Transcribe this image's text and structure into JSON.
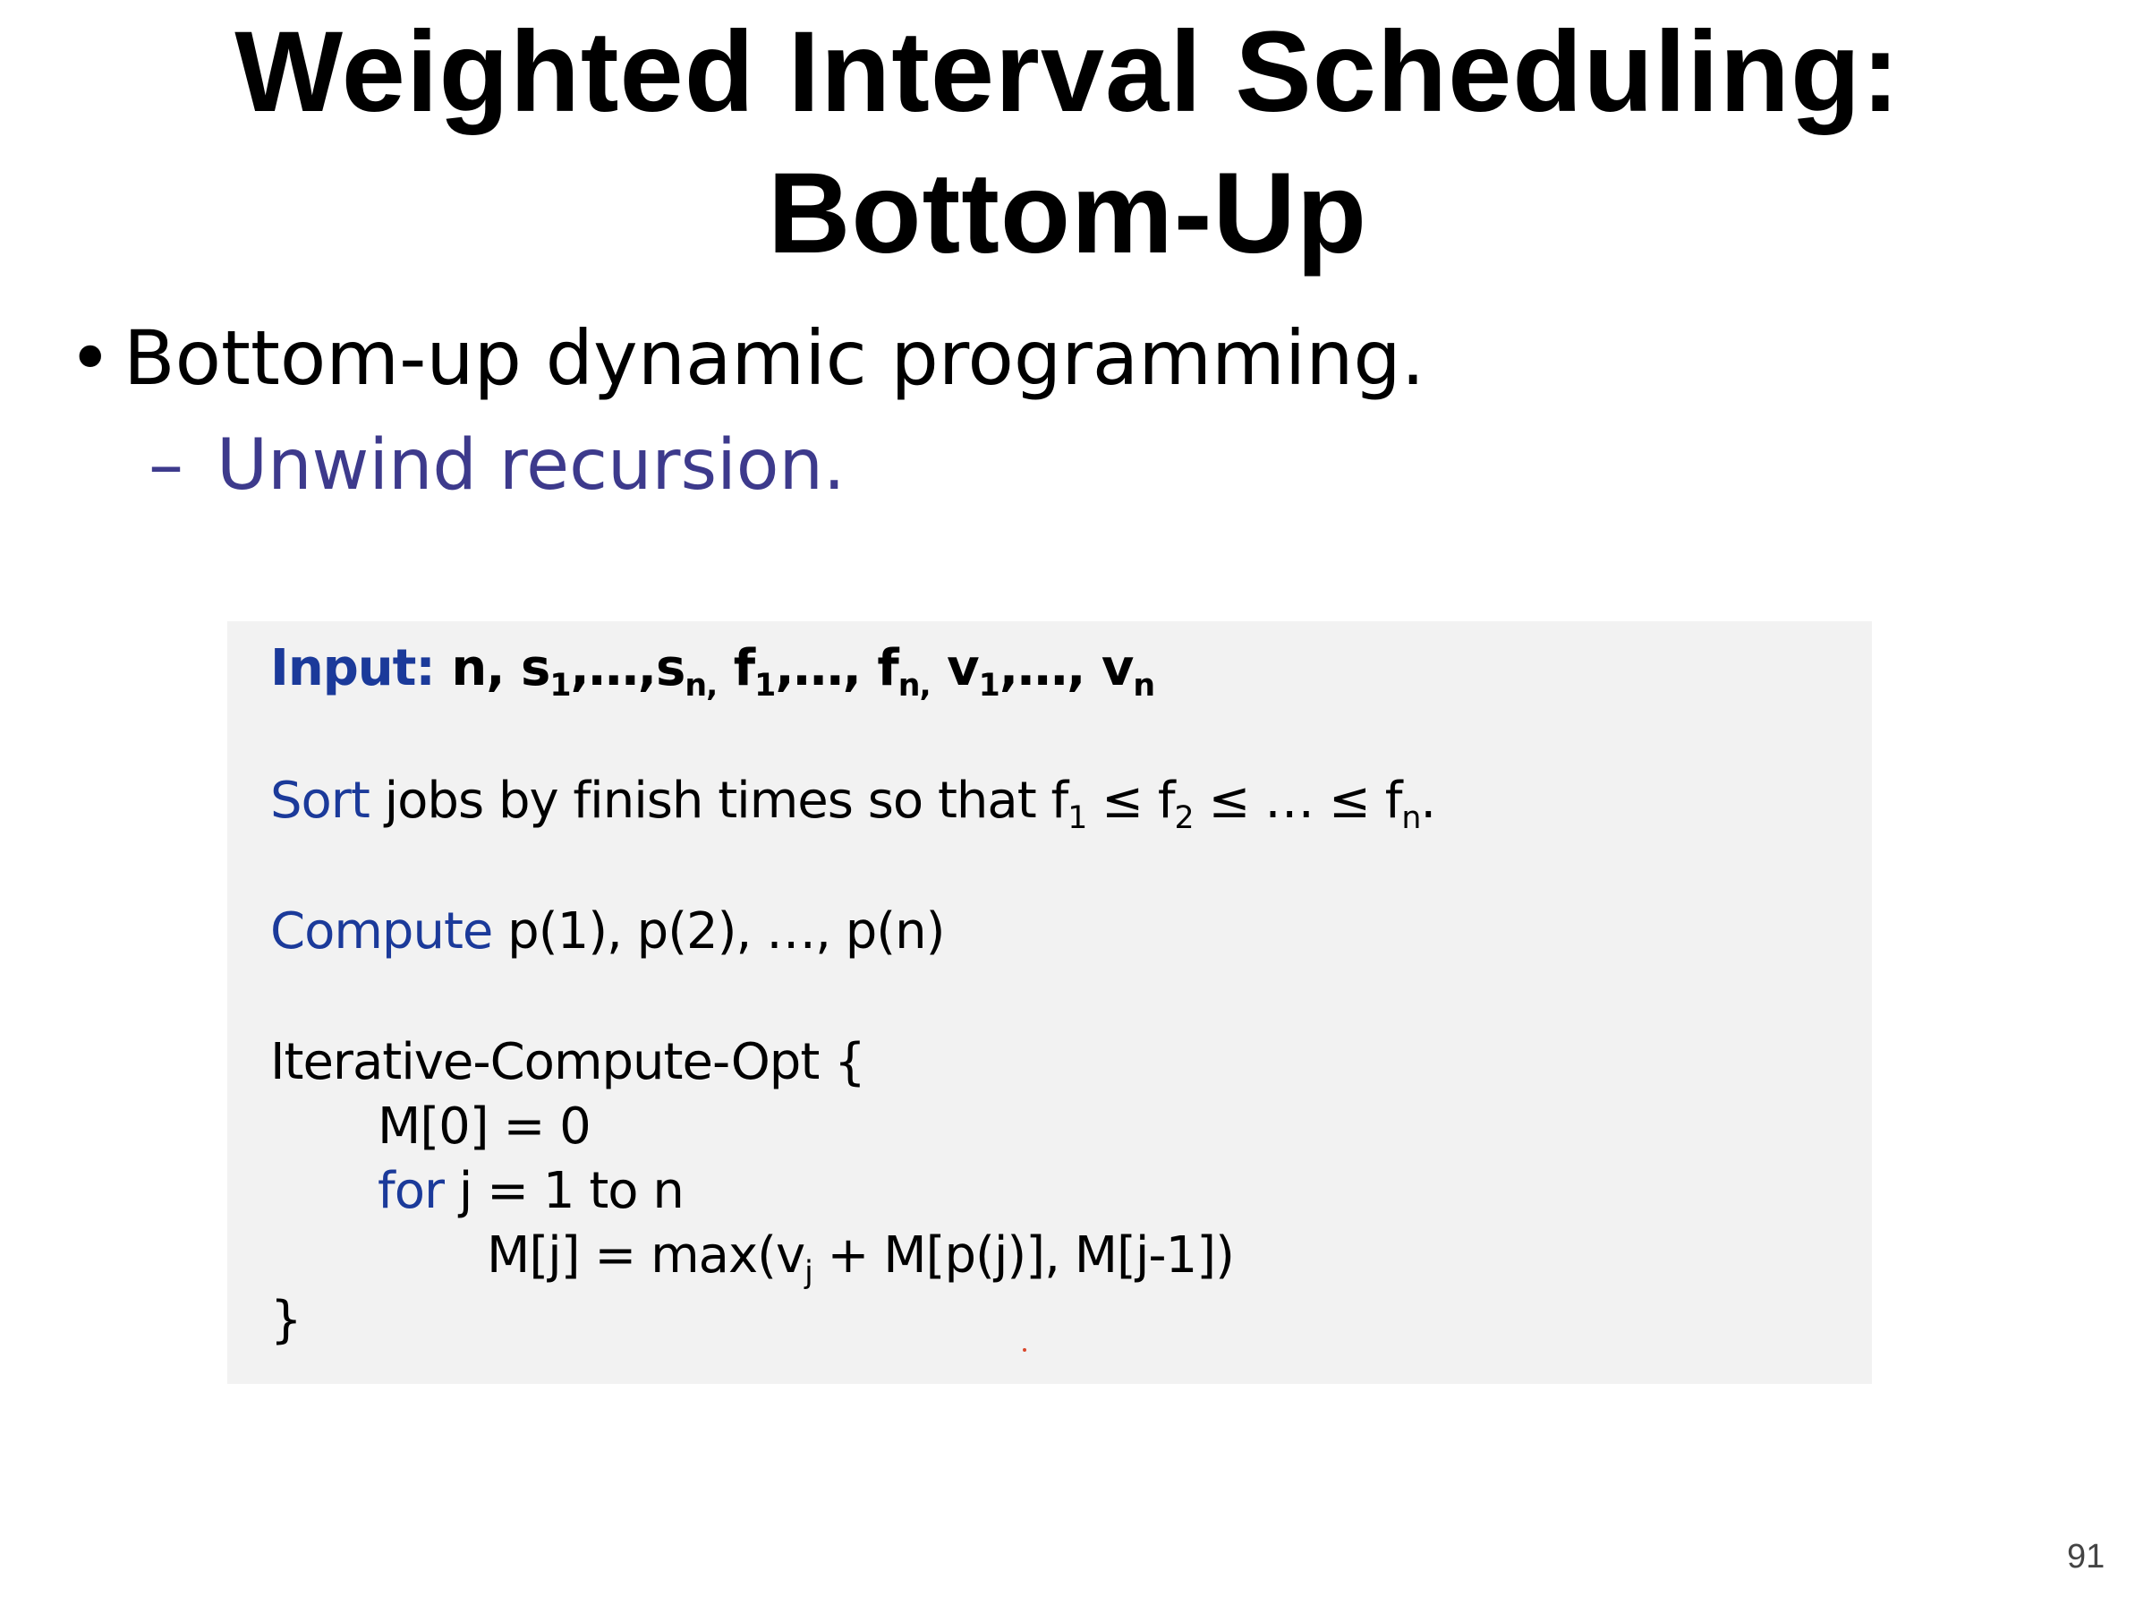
{
  "title": {
    "line1": "Weighted Interval Scheduling:",
    "line2": "Bottom-Up"
  },
  "bullets": [
    {
      "text": "Bottom-up dynamic programming."
    }
  ],
  "subbullets": [
    {
      "text": "Unwind recursion."
    }
  ],
  "code": {
    "input_keyword": "Input:",
    "input_n": " n, ",
    "input_s": "s",
    "sub_1": "1",
    "sub_n": "n",
    "input_dots": ",…,",
    "comma": ",",
    "input_f": " f",
    "input_v": " v",
    "sort_keyword": "Sort",
    "sort_text_a": " jobs by finish times so that f",
    "sort_le": " ≤ f",
    "sub_2": "2",
    "sort_ellipsis": " ≤ … ≤ f",
    "period": ".",
    "compute_keyword": "Compute",
    "compute_text": " p(1), p(2), …, p(n)",
    "func_header": "Iterative-Compute-Opt {",
    "m0": "M[0] = 0",
    "for_keyword": "for",
    "for_text": " j = 1 to n",
    "mj_a": "M[j] = max(v",
    "sub_j": "j",
    "mj_b": " + M[p(j)], M[j-1])",
    "close_brace": "}"
  },
  "page_number": "91"
}
